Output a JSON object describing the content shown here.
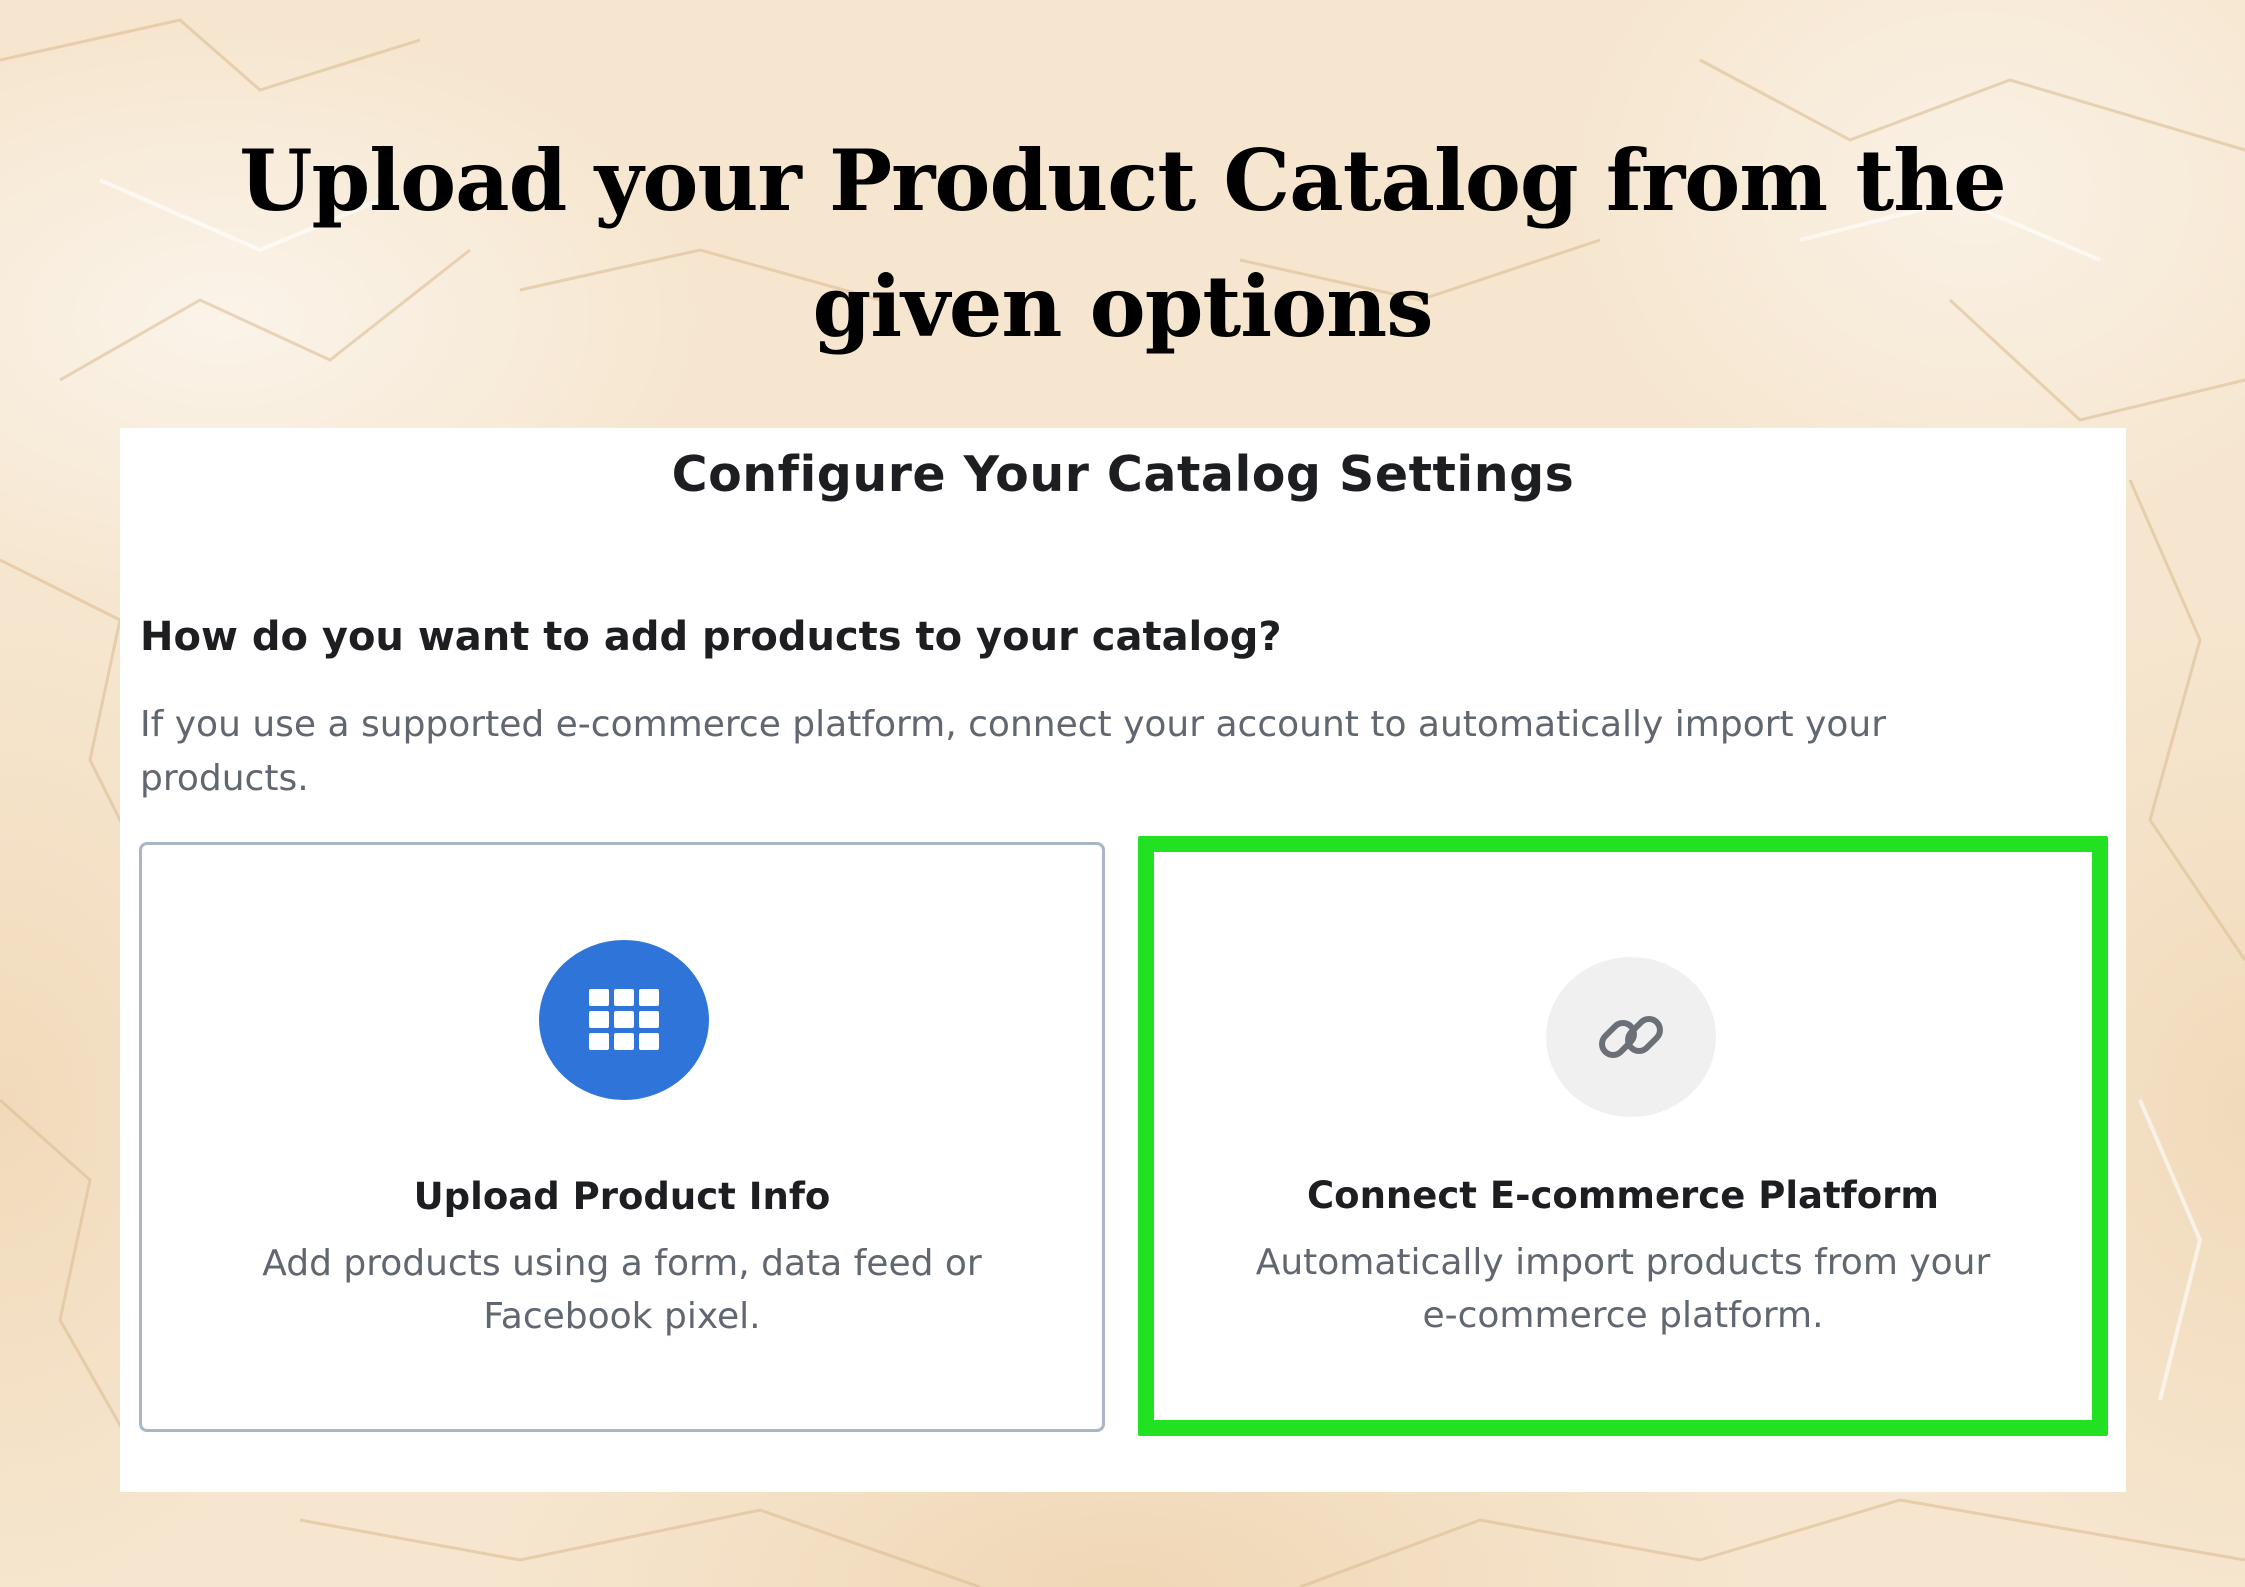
{
  "headline": "Upload your Product Catalog from the given options",
  "panel": {
    "title": "Configure Your Catalog Settings",
    "question": "How do you want to add products to your catalog?",
    "description": "If you use a supported e-commerce platform, connect your account to automatically import your products."
  },
  "options": [
    {
      "icon": "grid-icon",
      "title": "Upload Product Info",
      "description": "Add products using a form, data feed or Facebook pixel.",
      "highlighted": false
    },
    {
      "icon": "link-icon",
      "title": "Connect E-commerce Platform",
      "description": "Automatically import products from your e-commerce platform.",
      "highlighted": true
    }
  ],
  "colors": {
    "background": "#f6e6cf",
    "upload_icon_bg": "#2f74d9",
    "highlight_border": "#22e022",
    "card_border": "#a9b6c8"
  }
}
